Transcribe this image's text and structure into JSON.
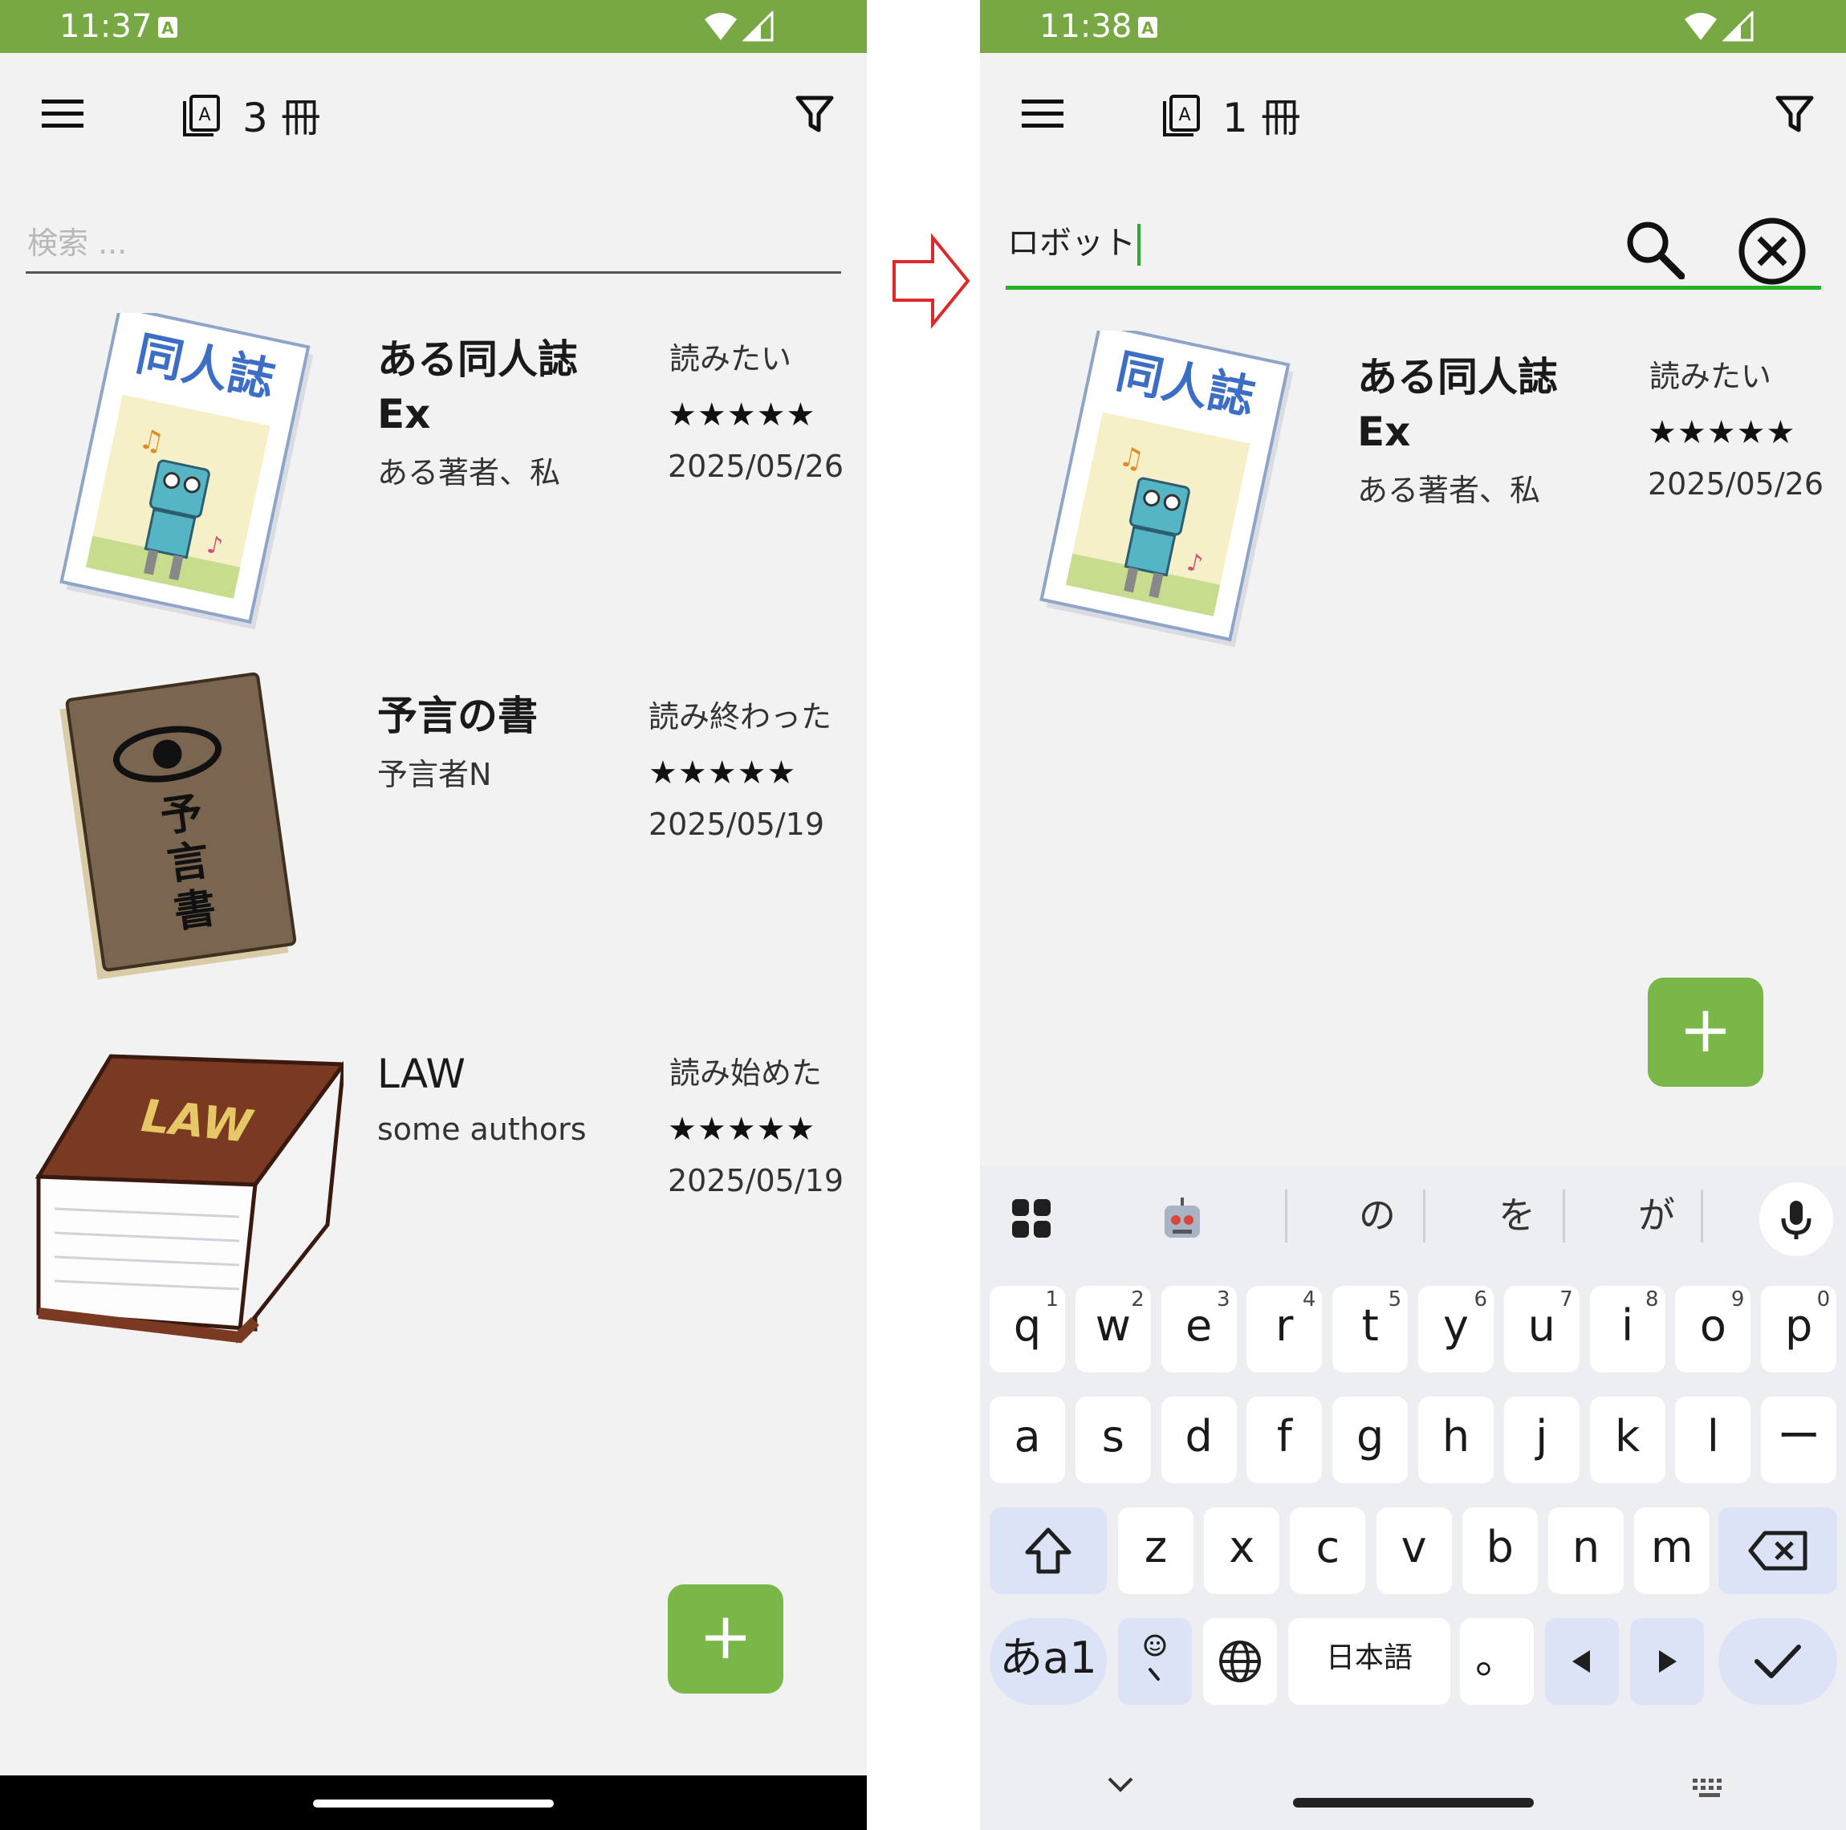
{
  "left": {
    "status_bar": {
      "time": "11:37"
    },
    "toolbar": {
      "count": "3 冊"
    },
    "search": {
      "placeholder": "検索 ..."
    },
    "books": [
      {
        "title": "ある同人誌",
        "title2": "Ex",
        "author": "ある著者、私",
        "status": "読みたい",
        "stars": "★★★★★",
        "date": "2025/05/26"
      },
      {
        "title": "予言の書",
        "author": "予言者N",
        "status": "読み終わった",
        "stars": "★★★★★",
        "date": "2025/05/19"
      },
      {
        "title": "LAW",
        "author": "some authors",
        "status": "読み始めた",
        "stars": "★★★★★",
        "date": "2025/05/19"
      }
    ],
    "fab_label": "+"
  },
  "right": {
    "status_bar": {
      "time": "11:38"
    },
    "toolbar": {
      "count": "1 冊"
    },
    "search": {
      "value": "ロボット"
    },
    "books": [
      {
        "title": "ある同人誌",
        "title2": "Ex",
        "author": "ある著者、私",
        "status": "読みたい",
        "stars": "★★★★★",
        "date": "2025/05/26"
      }
    ],
    "fab_label": "+",
    "keyboard": {
      "candidates": [
        "の",
        "を",
        "が"
      ],
      "row1": [
        {
          "k": "q",
          "n": "1"
        },
        {
          "k": "w",
          "n": "2"
        },
        {
          "k": "e",
          "n": "3"
        },
        {
          "k": "r",
          "n": "4"
        },
        {
          "k": "t",
          "n": "5"
        },
        {
          "k": "y",
          "n": "6"
        },
        {
          "k": "u",
          "n": "7"
        },
        {
          "k": "i",
          "n": "8"
        },
        {
          "k": "o",
          "n": "9"
        },
        {
          "k": "p",
          "n": "0"
        }
      ],
      "row2": [
        "a",
        "s",
        "d",
        "f",
        "g",
        "h",
        "j",
        "k",
        "l",
        "ー"
      ],
      "row3": [
        "z",
        "x",
        "c",
        "v",
        "b",
        "n",
        "m"
      ],
      "lang_key": "あa1",
      "space_label": "日本語",
      "period_key": "。"
    }
  },
  "colors": {
    "accent": "#77a843",
    "fab": "#7ab648",
    "focus_line": "#26b226",
    "arrow": "#e0282a"
  }
}
